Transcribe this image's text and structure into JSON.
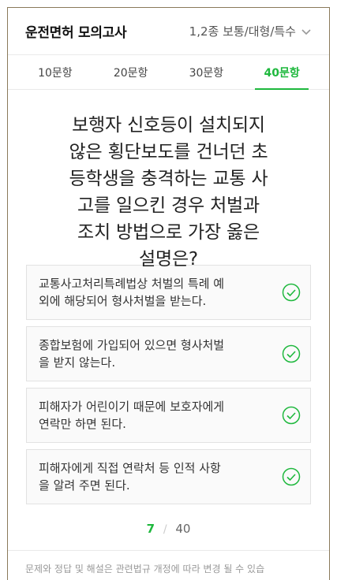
{
  "header": {
    "title": "운전면허 모의고사",
    "category": "1,2종 보통/대형/특수"
  },
  "tabs": [
    {
      "label": "10문항",
      "active": false
    },
    {
      "label": "20문항",
      "active": false
    },
    {
      "label": "30문항",
      "active": false
    },
    {
      "label": "40문항",
      "active": true
    }
  ],
  "question": {
    "lines": [
      "보행자 신호등이 설치되지",
      "않은 횡단보도를 건너던 초",
      "등학생을 충격하는 교통 사",
      "고를 일으킨 경우 처벌과",
      "조치 방법으로 가장 옳은",
      "설명은?"
    ]
  },
  "options": [
    {
      "line1": "교통사고처리특례법상 처벌의 특례 예",
      "line2": "외에 해당되어 형사처벌을 받는다."
    },
    {
      "line1": "종합보험에 가입되어 있으면 형사처벌",
      "line2": "을 받지 않는다."
    },
    {
      "line1": "피해자가 어린이기 때문에 보호자에게",
      "line2": "연락만 하면 된다."
    },
    {
      "line1": "피해자에게 직접 연락처 등 인적 사항",
      "line2": "을 알려 주면 된다."
    }
  ],
  "pager": {
    "current": "7",
    "separator": "/",
    "total": "40"
  },
  "footnote": "문제와 정답 및 해설은 관련법규 개정에 따라 변경 될 수 있습",
  "colors": {
    "accent": "#1eb83d",
    "border": "#e2e2e2"
  }
}
